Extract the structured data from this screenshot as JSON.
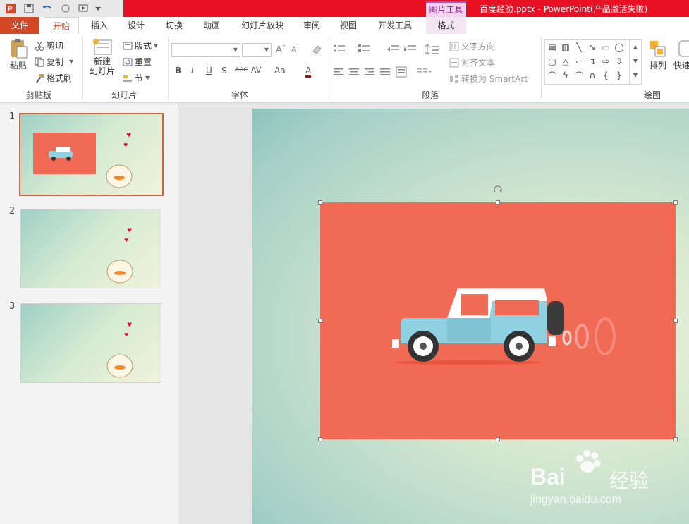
{
  "titlebar": {
    "context_tab_label": "图片工具",
    "document_title": "百度经验.pptx - PowerPoint(产品激活失败)"
  },
  "tabs": [
    "文件",
    "开始",
    "插入",
    "设计",
    "切换",
    "动画",
    "幻灯片放映",
    "审阅",
    "视图",
    "开发工具",
    "格式"
  ],
  "ribbon": {
    "clipboard": {
      "paste": "粘贴",
      "cut": "剪切",
      "copy": "复制",
      "format_painter": "格式刷",
      "label": "剪贴板"
    },
    "slides": {
      "new_slide_line1": "新建",
      "new_slide_line2": "幻灯片",
      "layout": "版式",
      "reset": "重置",
      "section": "节",
      "label": "幻灯片"
    },
    "font": {
      "font_name": "",
      "font_size": "",
      "bold": "B",
      "italic": "I",
      "underline": "U",
      "shadow": "S",
      "strike": "abc",
      "spacing": "AV",
      "case": "Aa",
      "color": "A",
      "label": "字体"
    },
    "paragraph": {
      "text_direction": "文字方向",
      "align_text": "对齐文本",
      "convert_smartart": "转换为 SmartArt",
      "label": "段落"
    },
    "drawing": {
      "arrange": "排列",
      "quick_styles": "快速",
      "label": "绘图"
    }
  },
  "slides_panel": {
    "numbers": [
      "1",
      "2",
      "3"
    ],
    "selected_index": 1
  },
  "watermark": {
    "brand": "Bai",
    "brand2": "经验",
    "url": "jingyan.baidu.com"
  },
  "colors": {
    "accent": "#d24726",
    "titlebar_red": "#e81123",
    "picture_bg": "#f06a55",
    "context_tab": "#b24eae"
  }
}
